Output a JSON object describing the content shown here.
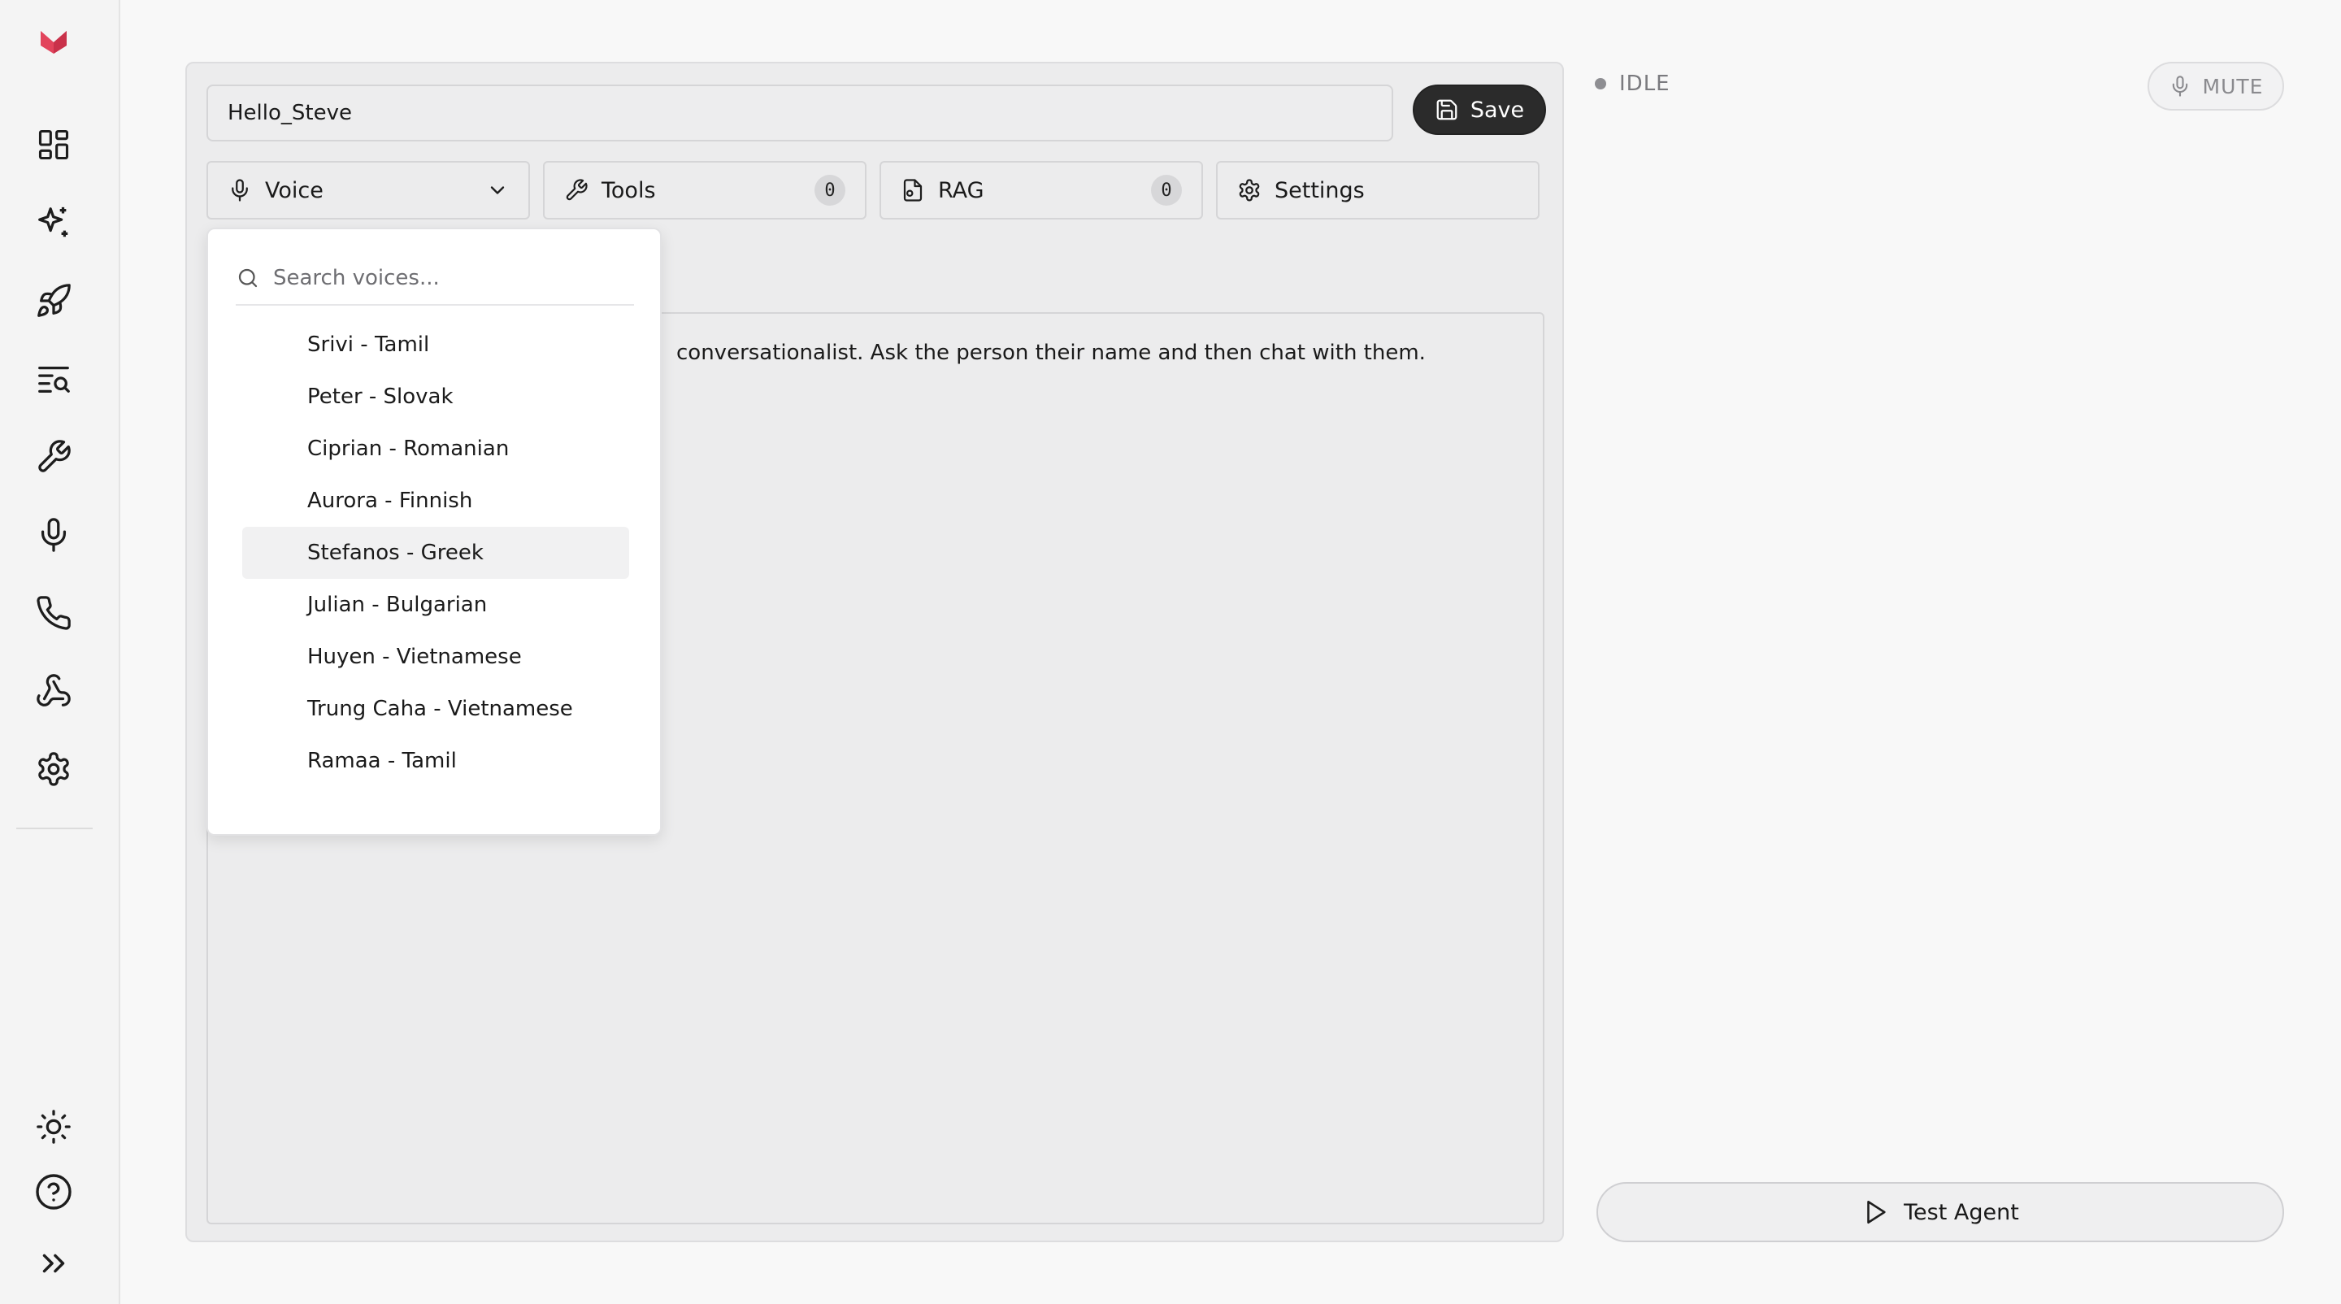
{
  "sidebar": {
    "logo_icon": "brand-logo-icon",
    "brand_color": "#e2445c",
    "items": [
      {
        "name": "dashboard",
        "icon": "grid-icon"
      },
      {
        "name": "agents",
        "icon": "sparkles-icon"
      },
      {
        "name": "deploy",
        "icon": "rocket-icon"
      },
      {
        "name": "logs",
        "icon": "list-search-icon"
      },
      {
        "name": "tools",
        "icon": "wrench-icon"
      },
      {
        "name": "voices",
        "icon": "mic-icon"
      },
      {
        "name": "phone",
        "icon": "phone-icon"
      },
      {
        "name": "webhooks",
        "icon": "webhook-icon"
      },
      {
        "name": "settings",
        "icon": "gear-icon"
      }
    ],
    "bottom": [
      {
        "name": "theme",
        "icon": "sun-icon"
      },
      {
        "name": "help",
        "icon": "help-circle-icon"
      },
      {
        "name": "expand",
        "icon": "chevrons-right-icon"
      }
    ]
  },
  "editor": {
    "agent_name": "Hello_Steve",
    "save_label": "Save",
    "tabs": [
      {
        "label": "Voice",
        "icon": "mic-icon"
      },
      {
        "label": "Tools",
        "icon": "wrench-icon",
        "count": "0"
      },
      {
        "label": "RAG",
        "icon": "file-icon",
        "count": "0"
      },
      {
        "label": "Settings",
        "icon": "gear-icon"
      }
    ],
    "prompt_visible_text": "conversationalist. Ask the person their name and then chat with them."
  },
  "voice_dropdown": {
    "search_placeholder": "Search voices...",
    "items": [
      "Srivi - Tamil",
      "Peter - Slovak",
      "Ciprian - Romanian",
      "Aurora - Finnish",
      "Stefanos - Greek",
      "Julian - Bulgarian",
      "Huyen - Vietnamese",
      "Trung Caha - Vietnamese",
      "Ramaa - Tamil"
    ],
    "highlighted": "Stefanos - Greek"
  },
  "right_panel": {
    "status": "IDLE",
    "mute_label": "MUTE",
    "test_label": "Test Agent"
  }
}
